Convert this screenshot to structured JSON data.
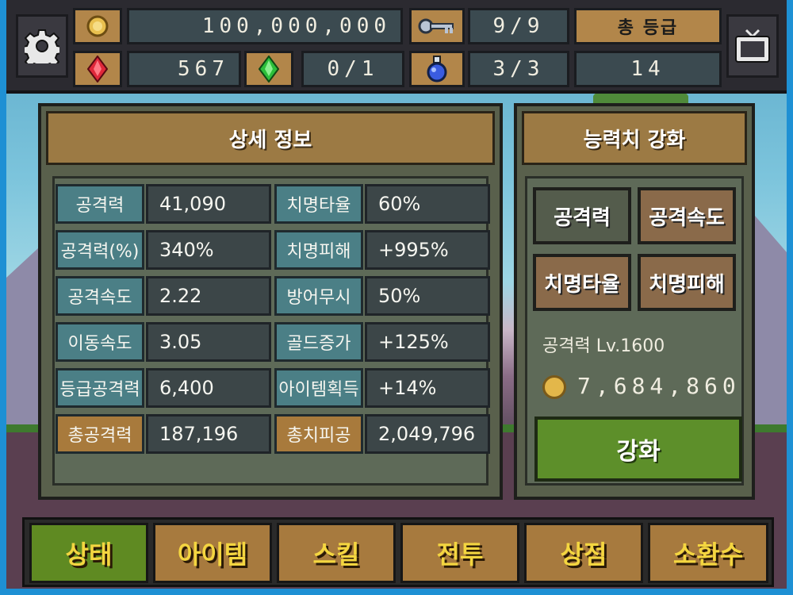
{
  "topbar": {
    "gold": "100,000,000",
    "keys": "9/9",
    "rank_label": "총 등급",
    "rubies": "567",
    "emeralds": "0/1",
    "potions": "3/3",
    "rank_value": "14",
    "icons": {
      "settings": "gear-icon",
      "gold": "coin-icon",
      "key": "key-icon",
      "ruby": "ruby-icon",
      "emerald": "emerald-icon",
      "potion": "potion-icon",
      "tv": "tv-icon"
    }
  },
  "detail_panel": {
    "title": "상세 정보",
    "rows": [
      {
        "label_left": "공격력",
        "value_left": "41,090",
        "label_right": "치명타율",
        "value_right": "60%"
      },
      {
        "label_left": "공격력(%)",
        "value_left": "340%",
        "label_right": "치명피해",
        "value_right": "+995%"
      },
      {
        "label_left": "공격속도",
        "value_left": "2.22",
        "label_right": "방어무시",
        "value_right": "50%"
      },
      {
        "label_left": "이동속도",
        "value_left": "3.05",
        "label_right": "골드증가",
        "value_right": "+125%"
      },
      {
        "label_left": "등급공격력",
        "value_left": "6,400",
        "label_right": "아이템획득",
        "value_right": "+14%"
      },
      {
        "label_left": "총공격력",
        "value_left": "187,196",
        "label_right": "총치피공",
        "value_right": "2,049,796"
      }
    ]
  },
  "upgrade_panel": {
    "title": "능력치 강화",
    "buttons": [
      "공격력",
      "공격속도",
      "치명타율",
      "치명피해"
    ],
    "level_text": "공격력 Lv.1600",
    "cost": "7,684,860",
    "enhance_label": "강화"
  },
  "bottom_nav": {
    "tabs": [
      "상태",
      "아이템",
      "스킬",
      "전투",
      "상점",
      "소환수"
    ],
    "active": 0
  },
  "colors": {
    "accent_gold": "#f4d640",
    "active_tab": "#5f8a22",
    "panel_brown": "#9c7a44",
    "stat_blue": "#4b7f86"
  }
}
